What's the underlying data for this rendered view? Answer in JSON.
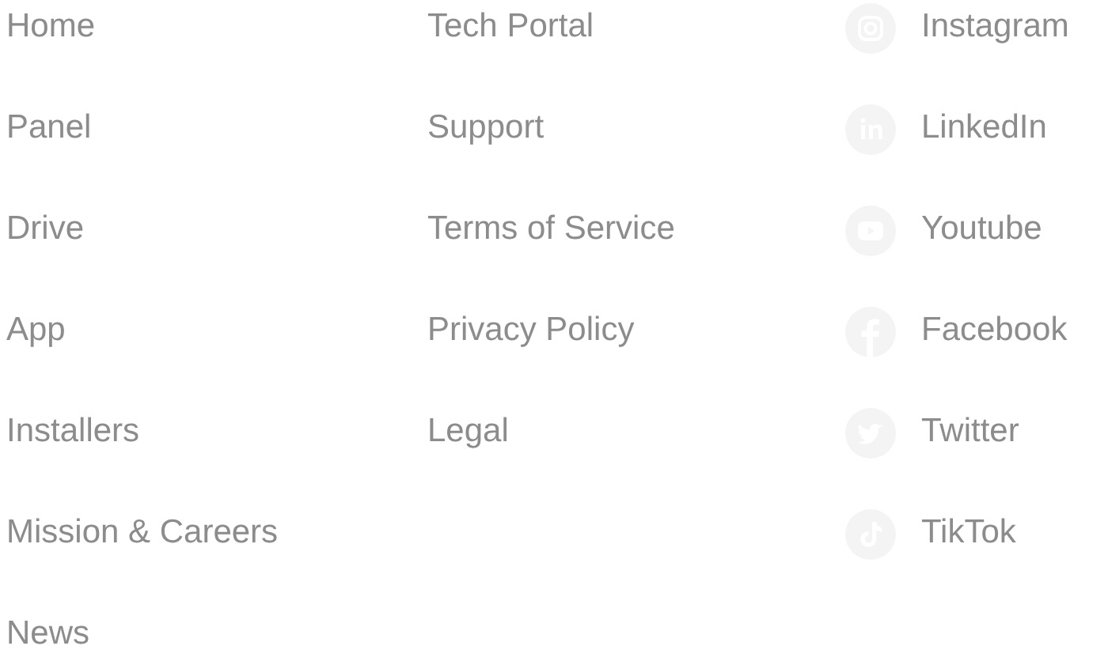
{
  "columns": [
    {
      "links": [
        "Home",
        "Panel",
        "Drive",
        "App",
        "Installers",
        "Mission & Careers",
        "News"
      ]
    },
    {
      "links": [
        "Tech Portal",
        "Support",
        "Terms of Service",
        "Privacy Policy",
        "Legal"
      ]
    }
  ],
  "social": [
    "Instagram",
    "LinkedIn",
    "Youtube",
    "Facebook",
    "Twitter",
    "TikTok"
  ]
}
